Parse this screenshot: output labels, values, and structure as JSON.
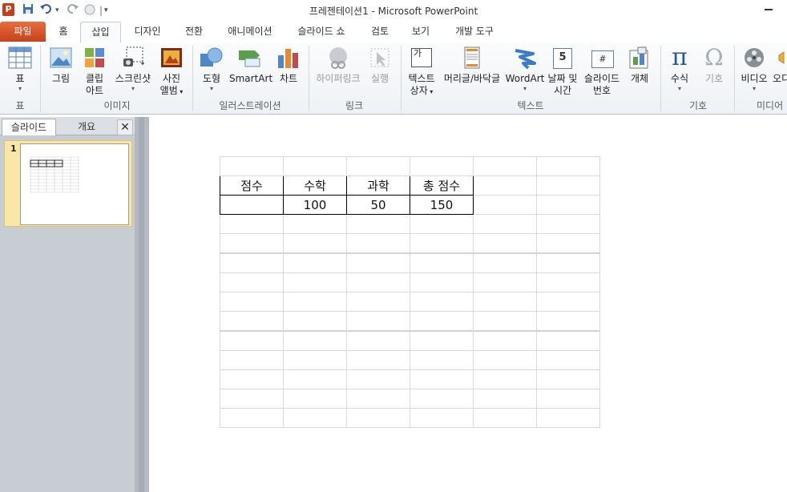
{
  "titlebar": {
    "app_icon": "P",
    "title": "프레젠테이션1  -  Microsoft PowerPoint",
    "qat_undo_dropdown": "▾",
    "qat_separator": "|"
  },
  "tabs": [
    {
      "label": "파일"
    },
    {
      "label": "홈"
    },
    {
      "label": "삽입"
    },
    {
      "label": "디자인"
    },
    {
      "label": "전환"
    },
    {
      "label": "애니메이션"
    },
    {
      "label": "슬라이드 쇼"
    },
    {
      "label": "검토"
    },
    {
      "label": "보기"
    },
    {
      "label": "개발 도구"
    }
  ],
  "ribbon": {
    "groups": {
      "table": "표",
      "images": "이미지",
      "illustrations": "일러스트레이션",
      "links": "링크",
      "text": "텍스트",
      "symbols": "기호",
      "media": "미디어"
    },
    "buttons": {
      "table": "표",
      "picture": "그림",
      "clipart_line1": "클립",
      "clipart_line2": "아트",
      "screenshot": "스크린샷",
      "album_line1": "사진",
      "album_line2": "앨범",
      "shapes": "도형",
      "smartart": "SmartArt",
      "chart": "차트",
      "hyperlink": "하이퍼링크",
      "action": "실행",
      "textbox_line1": "텍스트",
      "textbox_line2": "상자",
      "header_footer": "머리글/바닥글",
      "wordart": "WordArt",
      "datetime_line1": "날짜 및",
      "datetime_line2": "시간",
      "slidenum_line1": "슬라이드",
      "slidenum_line2": "번호",
      "object": "개체",
      "equation": "수식",
      "symbol": "기호",
      "video": "비디오",
      "audio": "오디"
    },
    "icons": {
      "textbox_glyph": "가",
      "slidenum_glyph": "#",
      "datetime_glyph": "5",
      "equation_glyph": "π",
      "symbol_glyph": "Ω"
    }
  },
  "leftpanel": {
    "tab_slides": "슬라이드",
    "tab_outline": "개요",
    "close": "✕",
    "slide_number": "1"
  },
  "slide": {
    "table": {
      "header": [
        "점수",
        "수학",
        "과학",
        "총 점수",
        "",
        ""
      ],
      "row1": [
        "",
        "100",
        "50",
        "150",
        "",
        ""
      ]
    }
  },
  "colors": {
    "file_tab": "#d24726",
    "accent": "#2b5797",
    "thumb_highlight": "#fbe7a5"
  }
}
